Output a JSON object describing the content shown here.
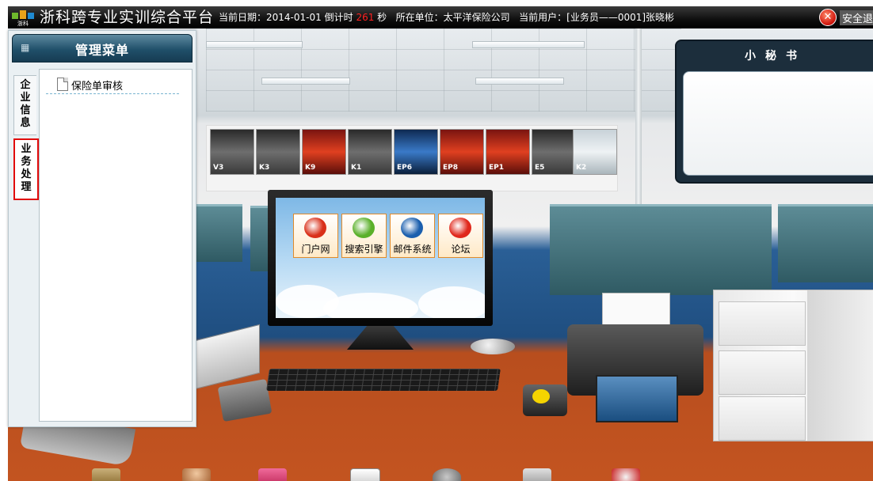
{
  "topbar": {
    "logo_text": "浙科",
    "app_title": "浙科跨专业实训综合平台",
    "date_label": "当前日期：",
    "date_value": "2014-01-01",
    "countdown_label": "倒计时",
    "countdown_value": "261",
    "countdown_unit": "秒",
    "unit_label": "所在单位：",
    "unit_value": "太平洋保险公司",
    "user_label": "当前用户：",
    "user_value": "[业务员——0001]张晓彬",
    "logout_label": "安全退"
  },
  "menu": {
    "title": "管理菜单",
    "tabs": [
      {
        "label": "企业信息"
      },
      {
        "label": "业务处理"
      }
    ],
    "items": [
      {
        "label": "保险单审核",
        "icon": "document-icon"
      }
    ]
  },
  "desktop_apps": [
    {
      "label": "门户网",
      "icon": "portal-icon",
      "color": "#d9301a"
    },
    {
      "label": "搜索引擎",
      "icon": "search-engine-icon",
      "color": "#5ab02a"
    },
    {
      "label": "邮件系统",
      "icon": "mail-icon",
      "color": "#1b5fae"
    },
    {
      "label": "论坛",
      "icon": "forum-icon",
      "color": "#e0281c"
    }
  ],
  "secretary": {
    "title": "小秘书"
  },
  "colors": {
    "topbar_bg": "#000000",
    "menu_header": "#20506a",
    "active_tab_border": "#e10b0b",
    "countdown": "#ff2020"
  }
}
